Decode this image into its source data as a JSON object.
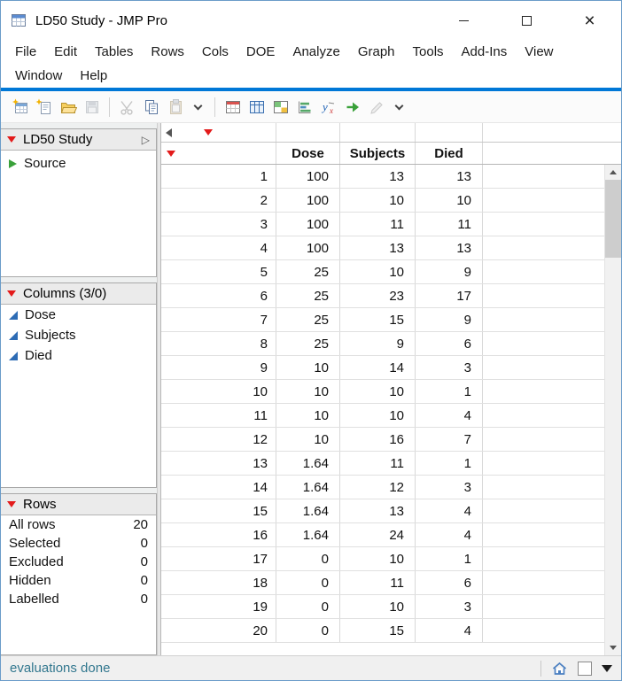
{
  "window": {
    "title": "LD50 Study - JMP Pro"
  },
  "menubar": {
    "items": [
      "File",
      "Edit",
      "Tables",
      "Rows",
      "Cols",
      "DOE",
      "Analyze",
      "Graph",
      "Tools",
      "Add-Ins",
      "View",
      "Window",
      "Help"
    ]
  },
  "toolbar": {
    "icons": [
      "new-data-table",
      "new-journal",
      "open-file",
      "save",
      "cut",
      "copy",
      "paste",
      "toolbar-overflow",
      "data-table",
      "summary-table",
      "split-table",
      "graph-builder",
      "formula",
      "run-script",
      "script-editor",
      "toolbar-overflow"
    ]
  },
  "sidebar": {
    "table_panel": {
      "title": "LD50 Study",
      "source": "Source"
    },
    "columns_panel": {
      "title": "Columns (3/0)",
      "items": [
        "Dose",
        "Subjects",
        "Died"
      ]
    },
    "rows_panel": {
      "title": "Rows",
      "stats": [
        {
          "label": "All rows",
          "value": "20"
        },
        {
          "label": "Selected",
          "value": "0"
        },
        {
          "label": "Excluded",
          "value": "0"
        },
        {
          "label": "Hidden",
          "value": "0"
        },
        {
          "label": "Labelled",
          "value": "0"
        }
      ]
    }
  },
  "grid": {
    "columns": [
      "Dose",
      "Subjects",
      "Died"
    ],
    "rows": [
      {
        "n": "1",
        "dose": "100",
        "subjects": "13",
        "died": "13"
      },
      {
        "n": "2",
        "dose": "100",
        "subjects": "10",
        "died": "10"
      },
      {
        "n": "3",
        "dose": "100",
        "subjects": "11",
        "died": "11"
      },
      {
        "n": "4",
        "dose": "100",
        "subjects": "13",
        "died": "13"
      },
      {
        "n": "5",
        "dose": "25",
        "subjects": "10",
        "died": "9"
      },
      {
        "n": "6",
        "dose": "25",
        "subjects": "23",
        "died": "17"
      },
      {
        "n": "7",
        "dose": "25",
        "subjects": "15",
        "died": "9"
      },
      {
        "n": "8",
        "dose": "25",
        "subjects": "9",
        "died": "6"
      },
      {
        "n": "9",
        "dose": "10",
        "subjects": "14",
        "died": "3"
      },
      {
        "n": "10",
        "dose": "10",
        "subjects": "10",
        "died": "1"
      },
      {
        "n": "11",
        "dose": "10",
        "subjects": "10",
        "died": "4"
      },
      {
        "n": "12",
        "dose": "10",
        "subjects": "16",
        "died": "7"
      },
      {
        "n": "13",
        "dose": "1.64",
        "subjects": "11",
        "died": "1"
      },
      {
        "n": "14",
        "dose": "1.64",
        "subjects": "12",
        "died": "3"
      },
      {
        "n": "15",
        "dose": "1.64",
        "subjects": "13",
        "died": "4"
      },
      {
        "n": "16",
        "dose": "1.64",
        "subjects": "24",
        "died": "4"
      },
      {
        "n": "17",
        "dose": "0",
        "subjects": "10",
        "died": "1"
      },
      {
        "n": "18",
        "dose": "0",
        "subjects": "11",
        "died": "6"
      },
      {
        "n": "19",
        "dose": "0",
        "subjects": "10",
        "died": "3"
      },
      {
        "n": "20",
        "dose": "0",
        "subjects": "15",
        "died": "4"
      }
    ]
  },
  "statusbar": {
    "text": "evaluations done",
    "icons": [
      "home-icon",
      "marker-box",
      "dropdown-caret"
    ]
  },
  "colors": {
    "accent": "#0078d7",
    "red_triangle": "#e31b1b",
    "green_triangle": "#3aa13a",
    "column_icon_blue": "#2d6cb5",
    "status_text": "#33788f"
  }
}
